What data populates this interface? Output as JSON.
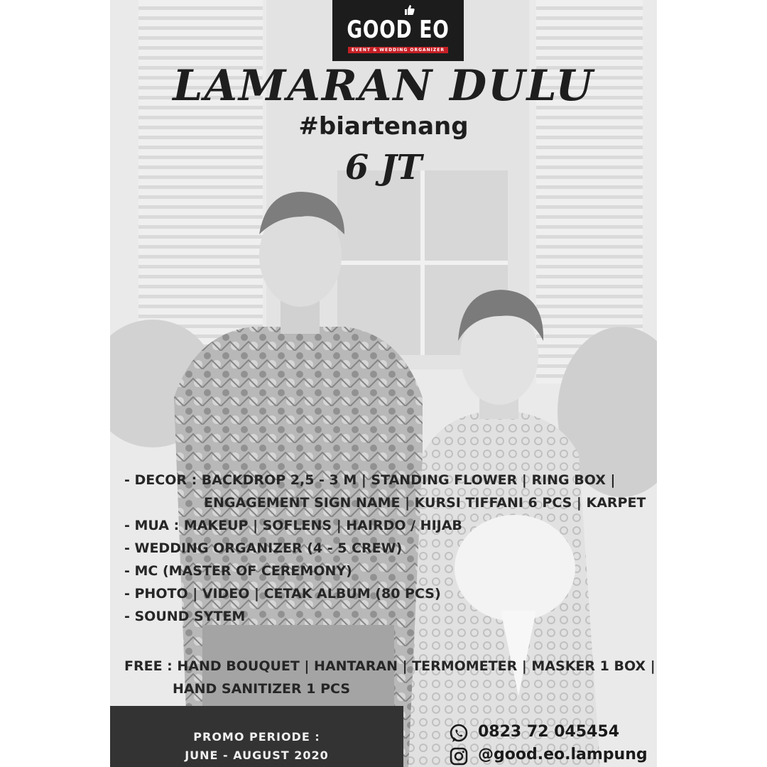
{
  "logo": {
    "name": "GOOD EO",
    "tagline": "EVENT & WEDDING ORGANIZER"
  },
  "headline": "LAMARAN DULU",
  "hashtag": "#biartenang",
  "price": "6 JT",
  "package_items": [
    "- DECOR : BACKDROP 2,5 - 3 M | STANDING FLOWER | RING BOX |",
    "ENGAGEMENT SIGN NAME | KURSI TIFFANI 6 PCS | KARPET",
    "- MUA : MAKEUP | SOFLENS | HAIRDO / HIJAB",
    "- WEDDING ORGANIZER (4 - 5 CREW)",
    "- MC (MASTER OF CEREMONY)",
    "- PHOTO | VIDEO | CETAK ALBUM (80 PCS)",
    "- SOUND SYTEM"
  ],
  "free_items": [
    "FREE : HAND BOUQUET | HANTARAN | TERMOMETER | MASKER 1 BOX |",
    "HAND SANITIZER 1 PCS"
  ],
  "promo": {
    "label": "PROMO PERIODE :",
    "period": "JUNE - AUGUST 2020"
  },
  "contact": {
    "phone": "0823 72 045454",
    "instagram": "@good.eo.lampung",
    "phone_icon": "whatsapp-icon",
    "instagram_icon": "instagram-icon"
  },
  "colors": {
    "logo_bg": "#1c1c1c",
    "logo_accent": "#c62026",
    "text": "#1e1e1e",
    "promo_bg": "#333333"
  }
}
